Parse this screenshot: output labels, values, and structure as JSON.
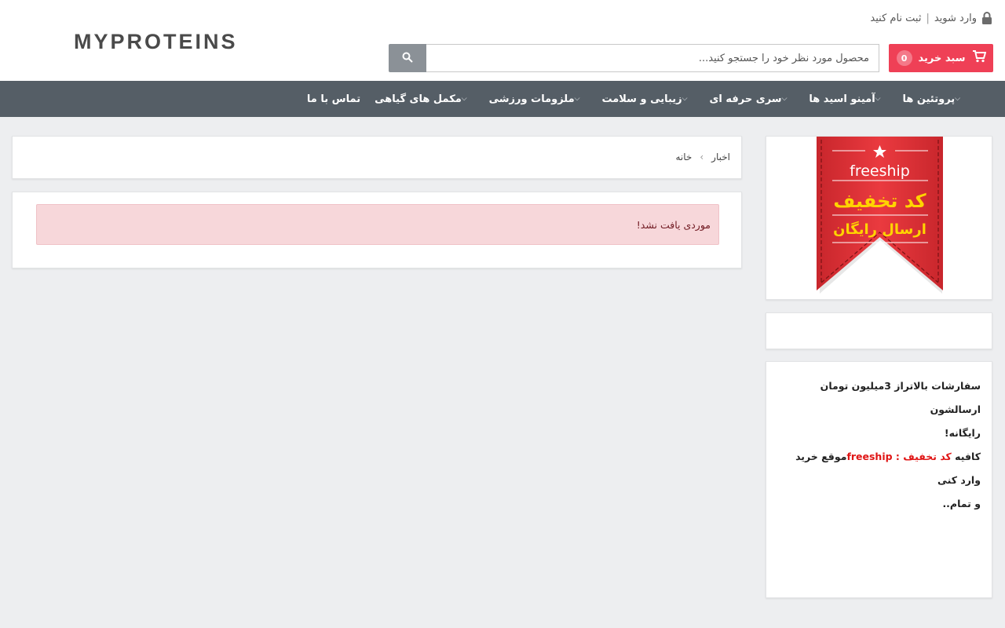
{
  "header": {
    "logo_text": "MYPROTEINS",
    "login_label": "وارد شوید",
    "separator": "|",
    "register_label": "ثبت نام کنید",
    "cart_label": "سبد خرید",
    "cart_count": "0",
    "search_placeholder": "محصول مورد نظر خود را جستجو کنید..."
  },
  "nav": {
    "items": [
      {
        "label": "پروتئین ها"
      },
      {
        "label": "آمینو اسید ها"
      },
      {
        "label": "سری حرفه ای"
      },
      {
        "label": "زیبایی و سلامت"
      },
      {
        "label": "ملزومات ورزشی"
      },
      {
        "label": "مکمل های گیاهی"
      },
      {
        "label": "تماس با ما"
      }
    ]
  },
  "breadcrumb": {
    "home": "خانه",
    "arrow": "›",
    "current": "اخبار"
  },
  "main": {
    "alert_text": "موردی یافت نشد!"
  },
  "promo": {
    "code": "freeship",
    "title": "کد تخفیف",
    "subtitle": "ارسال رایگان"
  },
  "info": {
    "line1": "سفارشات بالاتراز 3میلیون تومان ارسالشون",
    "line2": "رایگانه!",
    "line3_a": "کافیه ",
    "line3_b": "کد تخفیف : ",
    "line3_c": "freeship",
    "line3_d": "موقع خرید وارد کنی",
    "line4": "و تمام.."
  },
  "colors": {
    "accent": "#ef4056",
    "nav_bg": "#555e66",
    "alert_bg": "#f7d7da"
  }
}
